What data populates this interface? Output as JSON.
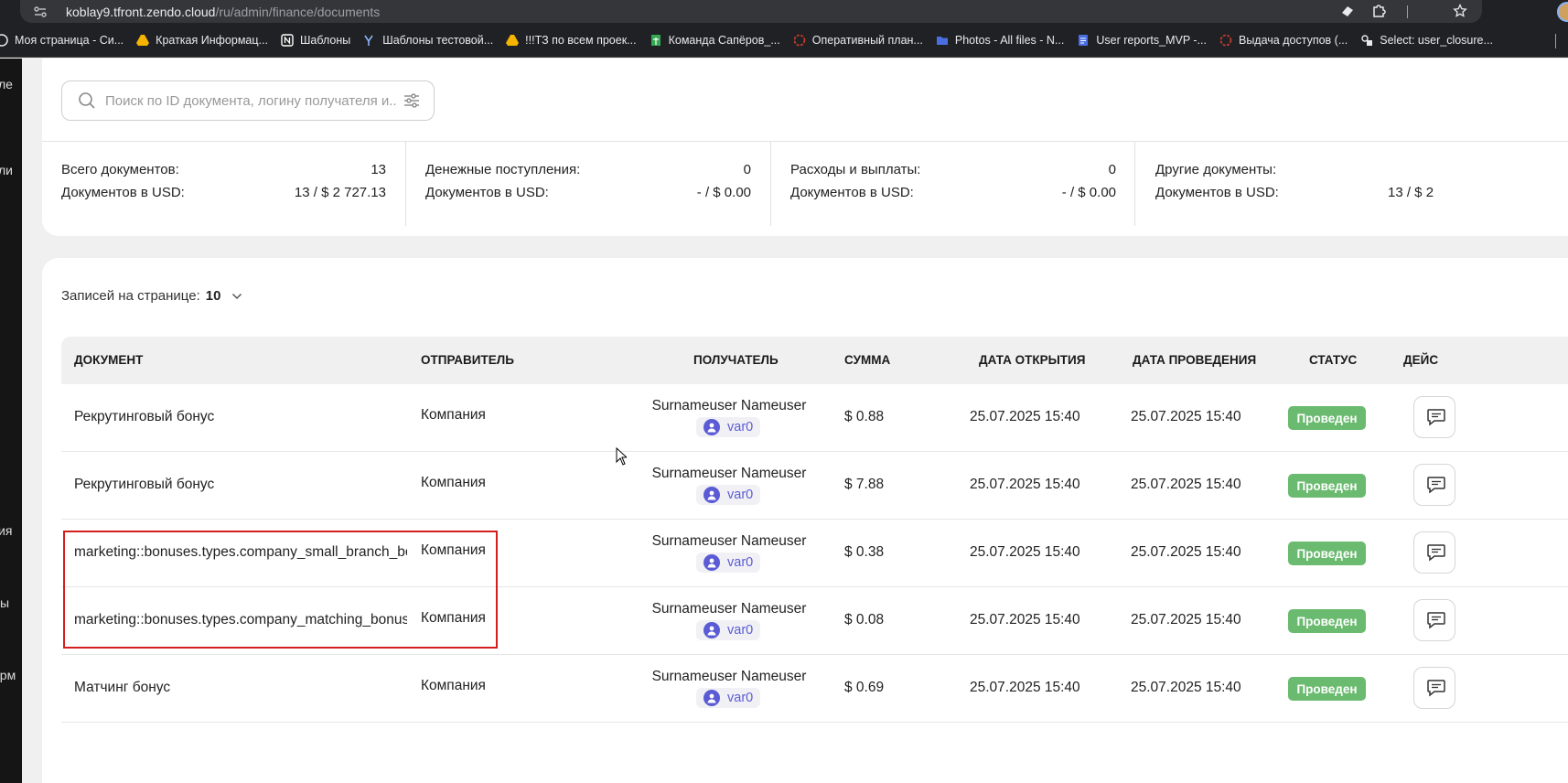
{
  "browser": {
    "url_host": "koblay9.tfront.zendo.cloud",
    "url_path": "/ru/admin/finance/documents",
    "bookmarks": [
      {
        "label": "Моя страница - Си...",
        "icon": "sber-icon",
        "color": "#e8eaed"
      },
      {
        "label": "Краткая Информац...",
        "icon": "google-drive-icon",
        "color": "#f4b400"
      },
      {
        "label": "Шаблоны",
        "icon": "notion-icon",
        "color": "#ffffff"
      },
      {
        "label": "Шаблоны тестовой...",
        "icon": "yandex-icon",
        "color": "#8ab4f8"
      },
      {
        "label": "!!!ТЗ по всем проек...",
        "icon": "google-drive-icon",
        "color": "#f4b400"
      },
      {
        "label": "Команда Сапёров_...",
        "icon": "google-sheets-icon",
        "color": "#34a853"
      },
      {
        "label": "Оперативный план...",
        "icon": "circle-icon",
        "color": "#c0392b"
      },
      {
        "label": "Photos - All files - N...",
        "icon": "folder-icon",
        "color": "#4a6ee0"
      },
      {
        "label": "User reports_MVP -...",
        "icon": "google-docs-icon",
        "color": "#4a6ee0"
      },
      {
        "label": "Выдача доступов (...",
        "icon": "circle-icon",
        "color": "#c0392b"
      },
      {
        "label": "Select: user_closure...",
        "icon": "db-icon",
        "color": "#e8eaed"
      }
    ]
  },
  "sidebar_fragments": [
    "ле",
    "ли",
    "ия",
    "ы",
    "орм"
  ],
  "search": {
    "placeholder": "Поиск по ID документа, логину получателя и..."
  },
  "stats": [
    {
      "label1": "Всего документов:",
      "value1": "13",
      "label2": "Документов в USD:",
      "value2": "13 / $ 2 727.13"
    },
    {
      "label1": "Денежные поступления:",
      "value1": "0",
      "label2": "Документов в USD:",
      "value2": "- / $ 0.00"
    },
    {
      "label1": "Расходы и выплаты:",
      "value1": "0",
      "label2": "Документов в USD:",
      "value2": "- / $ 0.00"
    },
    {
      "label1": "Другие документы:",
      "value1": "",
      "label2": "Документов в USD:",
      "value2": "13 / $ 2"
    }
  ],
  "pagination": {
    "label": "Записей на странице:",
    "value": "10"
  },
  "table": {
    "headers": {
      "document": "ДОКУМЕНТ",
      "sender": "ОТПРАВИТЕЛЬ",
      "recipient": "ПОЛУЧАТЕЛЬ",
      "amount": "СУММА",
      "opened": "ДАТА ОТКРЫТИЯ",
      "conducted": "ДАТА ПРОВЕДЕНИЯ",
      "status": "СТАТУС",
      "actions": "ДЕЙС"
    },
    "rows": [
      {
        "document": "Рекрутинговый бонус",
        "sender": "Компания",
        "recipient_name": "Surnameuser Nameuser",
        "recipient_login": "var0",
        "amount": "$ 0.88",
        "opened": "25.07.2025 15:40",
        "conducted": "25.07.2025 15:40",
        "status": "Проведен"
      },
      {
        "document": "Рекрутинговый бонус",
        "sender": "Компания",
        "recipient_name": "Surnameuser Nameuser",
        "recipient_login": "var0",
        "amount": "$ 7.88",
        "opened": "25.07.2025 15:40",
        "conducted": "25.07.2025 15:40",
        "status": "Проведен"
      },
      {
        "document": "marketing::bonuses.types.company_small_branch_bonu",
        "sender": "Компания",
        "recipient_name": "Surnameuser Nameuser",
        "recipient_login": "var0",
        "amount": "$ 0.38",
        "opened": "25.07.2025 15:40",
        "conducted": "25.07.2025 15:40",
        "status": "Проведен"
      },
      {
        "document": "marketing::bonuses.types.company_matching_bonus_pa",
        "sender": "Компания",
        "recipient_name": "Surnameuser Nameuser",
        "recipient_login": "var0",
        "amount": "$ 0.08",
        "opened": "25.07.2025 15:40",
        "conducted": "25.07.2025 15:40",
        "status": "Проведен"
      },
      {
        "document": "Матчинг бонус",
        "sender": "Компания",
        "recipient_name": "Surnameuser Nameuser",
        "recipient_login": "var0",
        "amount": "$ 0.69",
        "opened": "25.07.2025 15:40",
        "conducted": "25.07.2025 15:40",
        "status": "Проведен"
      }
    ]
  },
  "colors": {
    "status_done": "#6aba6f",
    "accent": "#5b5bd6",
    "highlight_border": "#d41f1f"
  }
}
